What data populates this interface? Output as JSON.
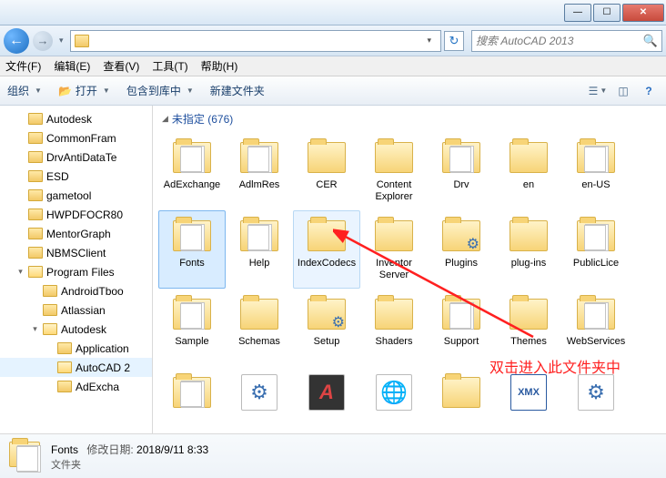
{
  "window": {
    "min": "—",
    "max": "☐",
    "close": "✕"
  },
  "nav": {
    "back": "←",
    "fwd": "→",
    "dd": "▾",
    "refresh": "↻"
  },
  "search": {
    "placeholder": "搜索 AutoCAD 2013",
    "icon": "🔍"
  },
  "menu": {
    "file": "文件(F)",
    "edit": "编辑(E)",
    "view": "查看(V)",
    "tools": "工具(T)",
    "help": "帮助(H)"
  },
  "toolbar": {
    "organize": "组织",
    "open": "打开",
    "open_icon": "📂",
    "include": "包含到库中",
    "new_folder": "新建文件夹",
    "dd": "▼"
  },
  "tree": [
    {
      "l": 1,
      "tw": "",
      "name": "Autodesk"
    },
    {
      "l": 1,
      "tw": "",
      "name": "CommonFram"
    },
    {
      "l": 1,
      "tw": "",
      "name": "DrvAntiDataTe"
    },
    {
      "l": 1,
      "tw": "",
      "name": "ESD"
    },
    {
      "l": 1,
      "tw": "",
      "name": "gametool"
    },
    {
      "l": 1,
      "tw": "",
      "name": "HWPDFOCR80"
    },
    {
      "l": 1,
      "tw": "",
      "name": "MentorGraph"
    },
    {
      "l": 1,
      "tw": "",
      "name": "NBMSClient"
    },
    {
      "l": 1,
      "tw": "▾",
      "name": "Program Files",
      "open": true
    },
    {
      "l": 2,
      "tw": "",
      "name": "AndroidTboo"
    },
    {
      "l": 2,
      "tw": "",
      "name": "Atlassian"
    },
    {
      "l": 2,
      "tw": "▾",
      "name": "Autodesk",
      "open": true
    },
    {
      "l": 3,
      "tw": "",
      "name": "Application"
    },
    {
      "l": 3,
      "tw": "",
      "name": "AutoCAD 2",
      "sel": true,
      "open": true
    },
    {
      "l": 3,
      "tw": "",
      "name": "AdExcha"
    }
  ],
  "group": {
    "tw": "◢",
    "label": "未指定 (676)"
  },
  "items_row1": [
    {
      "name": "AdExchange",
      "type": "folder-doc"
    },
    {
      "name": "AdlmRes",
      "type": "folder-doc"
    },
    {
      "name": "CER",
      "type": "folder"
    },
    {
      "name": "Content Explorer",
      "type": "folder"
    },
    {
      "name": "Drv",
      "type": "folder-doc"
    },
    {
      "name": "en",
      "type": "folder"
    },
    {
      "name": "en-US",
      "type": "folder-doc"
    }
  ],
  "items_row2": [
    {
      "name": "Fonts",
      "type": "folder-doc",
      "sel": true
    },
    {
      "name": "Help",
      "type": "folder-doc"
    },
    {
      "name": "IndexCodecs",
      "type": "folder",
      "hov": true
    },
    {
      "name": "Inventor Server",
      "type": "folder"
    },
    {
      "name": "Plugins",
      "type": "folder-gear"
    },
    {
      "name": "plug-ins",
      "type": "folder"
    },
    {
      "name": "PublicLice",
      "type": "folder-doc"
    }
  ],
  "items_row3": [
    {
      "name": "Sample",
      "type": "folder-doc"
    },
    {
      "name": "Schemas",
      "type": "folder"
    },
    {
      "name": "Setup",
      "type": "folder-gear"
    },
    {
      "name": "Shaders",
      "type": "folder"
    },
    {
      "name": "Support",
      "type": "folder-doc"
    },
    {
      "name": "Themes",
      "type": "folder"
    },
    {
      "name": "WebServices",
      "type": "folder-doc"
    }
  ],
  "items_row4": [
    {
      "name": "",
      "type": "folder-doc"
    },
    {
      "name": "",
      "type": "file-gear"
    },
    {
      "name": "",
      "type": "file-dark"
    },
    {
      "name": "",
      "type": "file-globe"
    },
    {
      "name": "",
      "type": "folder"
    },
    {
      "name": "",
      "type": "file-xmx"
    },
    {
      "name": "",
      "type": "file-gear"
    }
  ],
  "annotation": "双击进入此文件夹中",
  "details": {
    "name": "Fonts",
    "mod_label": "修改日期:",
    "mod_value": "2018/9/11 8:33",
    "type": "文件夹"
  }
}
